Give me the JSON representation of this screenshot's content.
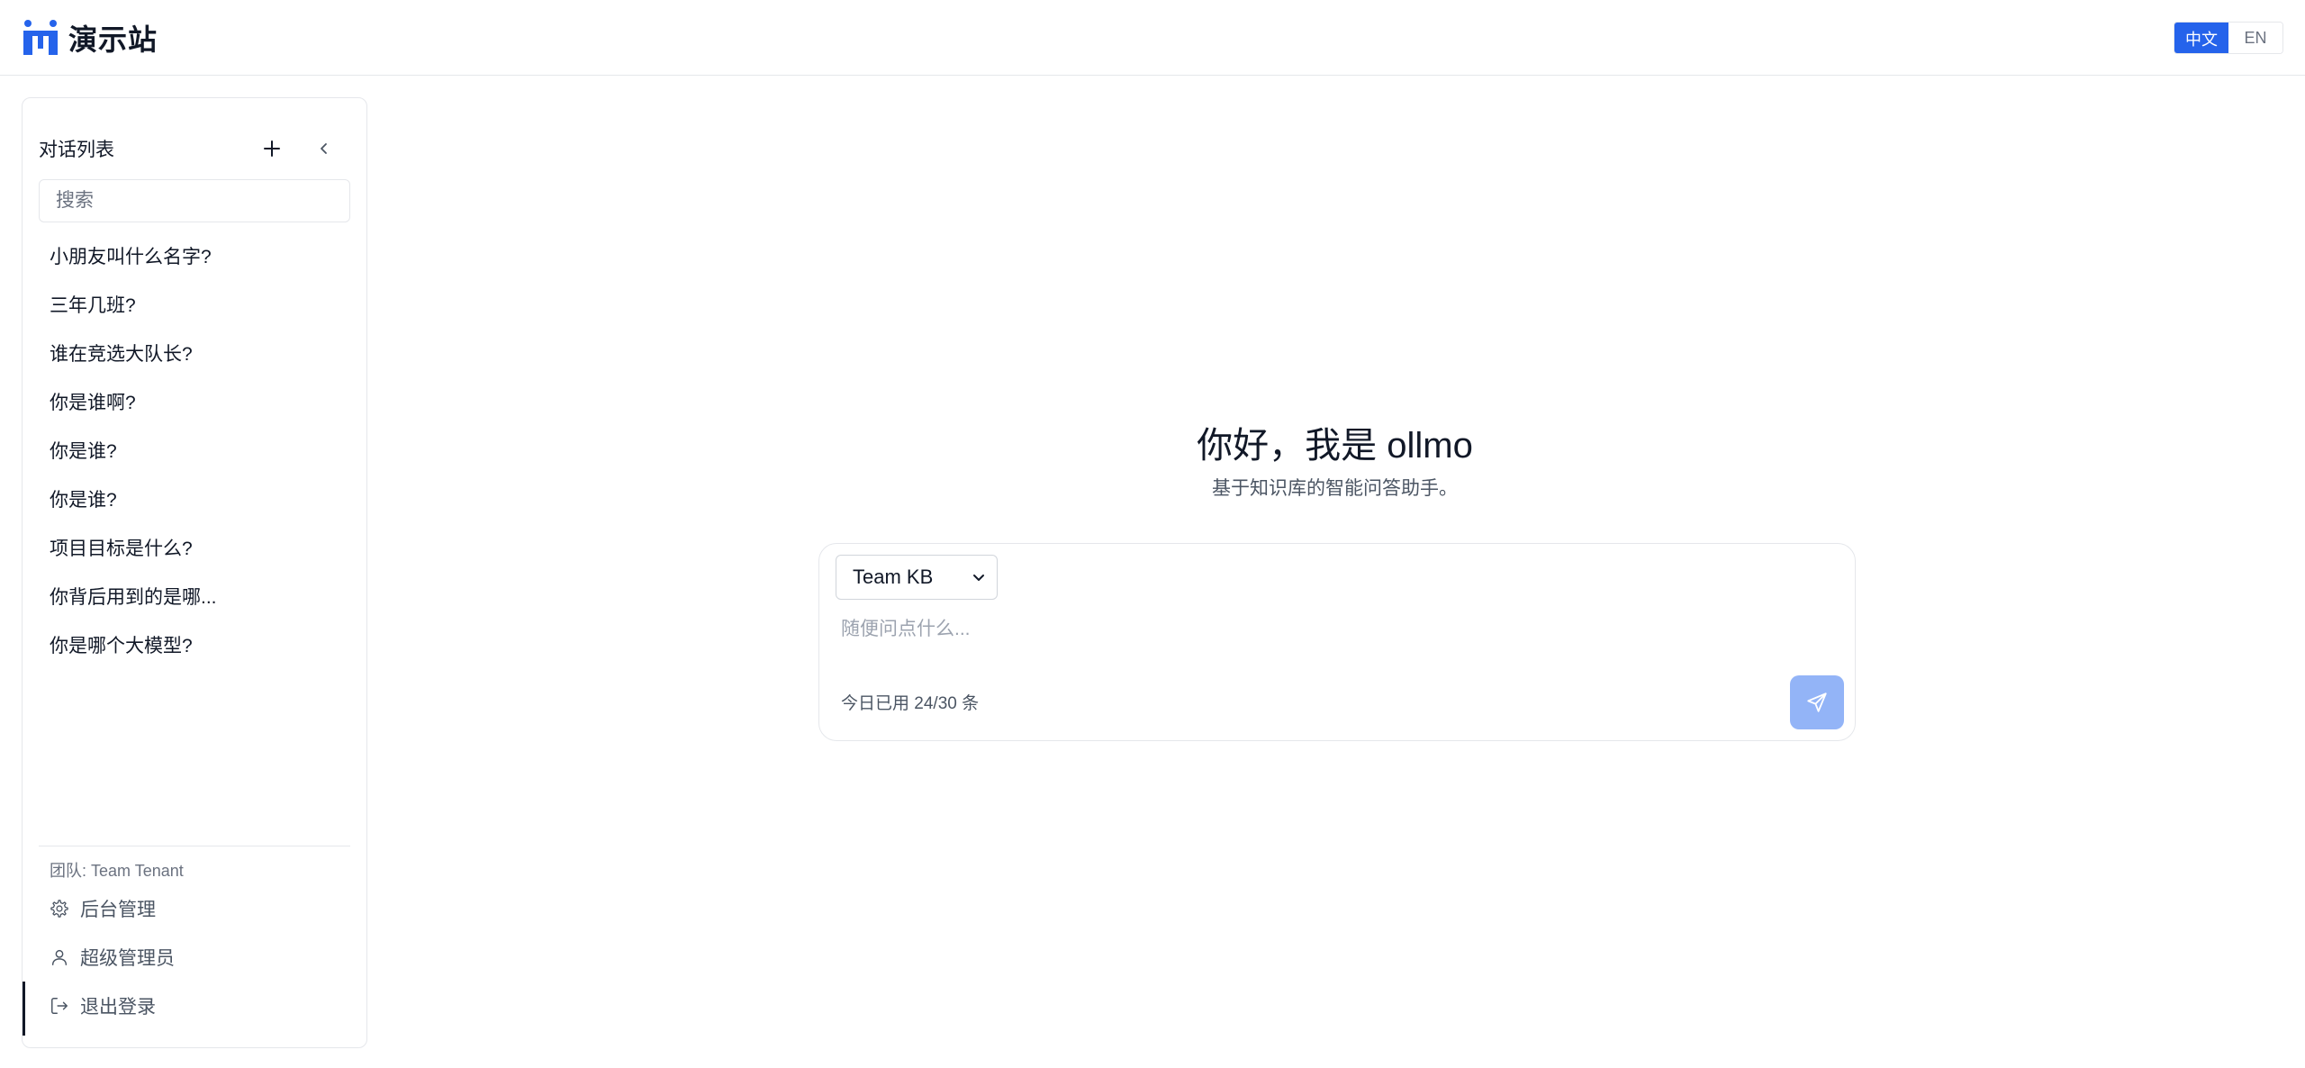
{
  "header": {
    "brand_name": "演示站",
    "lang_options": [
      "中文",
      "EN"
    ],
    "active_lang": "中文"
  },
  "sidebar": {
    "title": "对话列表",
    "search_placeholder": "搜索",
    "conversations": [
      "小朋友叫什么名字?",
      "三年几班?",
      "谁在竞选大队长?",
      "你是谁啊?",
      "你是谁?",
      "你是谁?",
      "项目目标是什么?",
      "你背后用到的是哪...",
      "你是哪个大模型?"
    ],
    "team_label": "团队: Team Tenant",
    "admin_label": "后台管理",
    "user_label": "超级管理员",
    "logout_label": "退出登录"
  },
  "main": {
    "welcome_title": "你好，我是 ollmo",
    "welcome_subtitle": "基于知识库的智能问答助手。",
    "kb_selected": "Team KB",
    "prompt_placeholder": "随便问点什么...",
    "quota_text": "今日已用 24/30 条"
  },
  "colors": {
    "accent": "#2563eb",
    "send_disabled": "#93b4f7",
    "border": "#e5e7eb"
  }
}
